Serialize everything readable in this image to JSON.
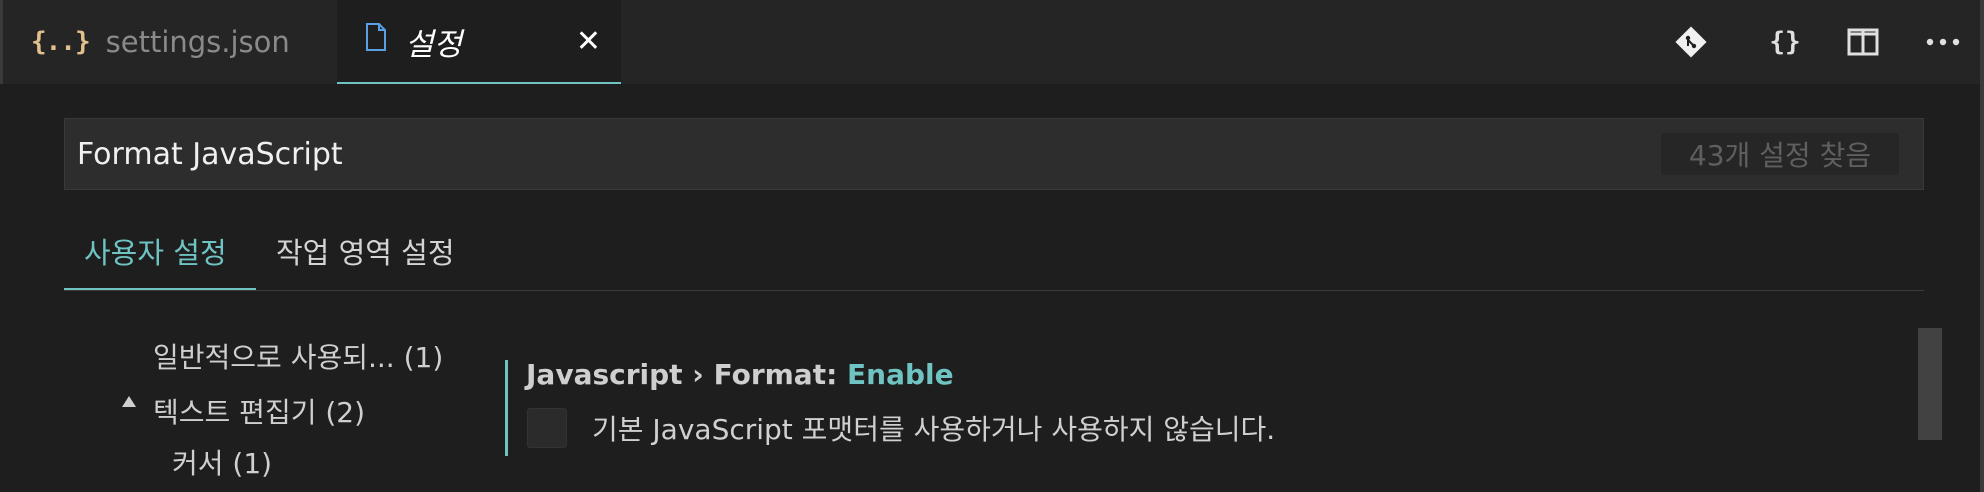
{
  "tabs": {
    "inactive": {
      "icon": "json-braces-icon",
      "icon_glyph": "{..}",
      "label": "settings.json"
    },
    "active": {
      "icon": "file-icon",
      "label": "설정",
      "close_glyph": "✕"
    }
  },
  "toolbar": {
    "icons": [
      "git-open-changes-icon",
      "open-json-braces-icon",
      "split-editor-icon",
      "more-actions-icon"
    ],
    "braces_glyph": "{}"
  },
  "search": {
    "value": "Format JavaScript",
    "result_count": "43개 설정 찾음"
  },
  "scopes": {
    "user": "사용자 설정",
    "workspace": "작업 영역 설정"
  },
  "tree": {
    "item_1": "일반적으로 사용되... (1)",
    "item_2": "텍스트 편집기 (2)",
    "item_3": "커서 (1)"
  },
  "setting": {
    "category": "Javascript › Format: ",
    "name": "Enable",
    "description": "기본 JavaScript 포맷터를 사용하거나 사용하지 않습니다.",
    "checked": false
  },
  "colors": {
    "accent": "#6fc3c3",
    "background": "#1e1e1e",
    "tabbar": "#252526"
  }
}
